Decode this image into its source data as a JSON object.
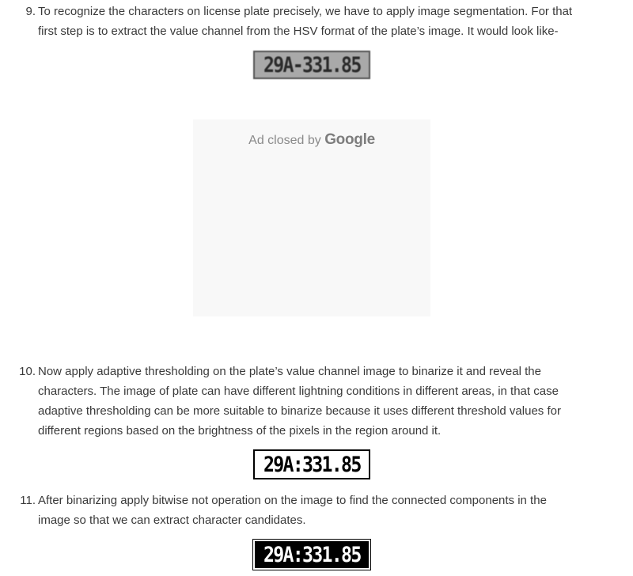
{
  "steps": [
    {
      "number": "9.",
      "lines": [
        "To recognize the characters on license plate precisely, we have to apply image segmentation. For that",
        "first step is to extract the value channel from the HSV format of the plate’s image. It would look like-"
      ]
    },
    {
      "number": "10.",
      "lines": [
        "Now apply adaptive thresholding on the plate’s value channel image to binarize it and reveal the",
        "characters. The image of plate can have different lightning conditions in different areas, in that case",
        "adaptive thresholding can be more suitable to binarize because it uses different threshold values for",
        "different regions based on the brightness of the pixels in the region around it."
      ]
    },
    {
      "number": "11.",
      "lines": [
        "After binarizing apply bitwise not operation on the image to find the connected components in the",
        "image so that we can extract character candidates."
      ]
    }
  ],
  "plates": {
    "value_channel": "29A-331.85",
    "binarized": "29A:331.85",
    "inverted": "29A:331.85"
  },
  "ad": {
    "closed_text": "Ad closed by",
    "brand": "Google"
  }
}
